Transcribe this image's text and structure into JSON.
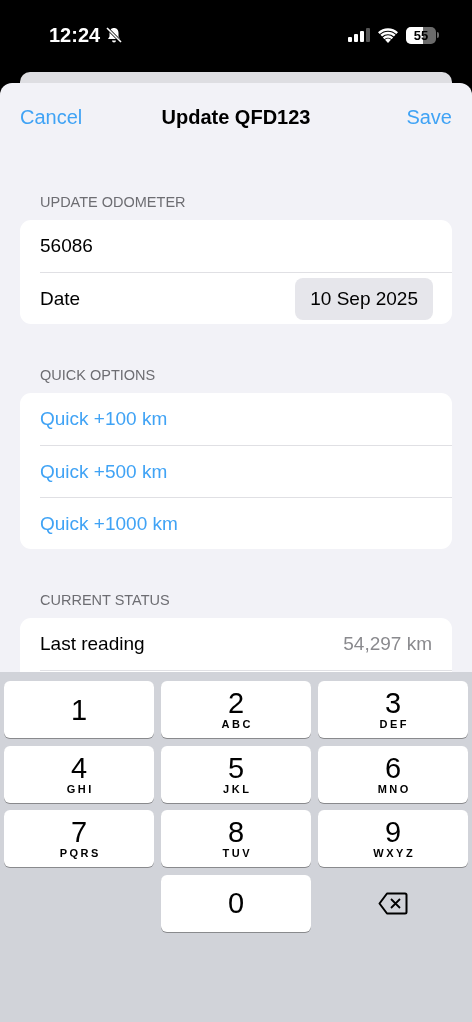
{
  "status_bar": {
    "time": "12:24",
    "silent": true,
    "battery": "55"
  },
  "nav": {
    "cancel": "Cancel",
    "title": "Update QFD123",
    "save": "Save"
  },
  "sections": [
    {
      "header": "UPDATE ODOMETER",
      "rows": [
        {
          "kind": "input",
          "value": "56086"
        },
        {
          "kind": "date",
          "label": "Date",
          "value": "10 Sep 2025"
        }
      ]
    },
    {
      "header": "QUICK OPTIONS",
      "rows": [
        {
          "kind": "action",
          "label": "Quick +100 km"
        },
        {
          "kind": "action",
          "label": "Quick +500 km"
        },
        {
          "kind": "action",
          "label": "Quick +1000 km"
        }
      ]
    },
    {
      "header": "CURRENT STATUS",
      "rows": [
        {
          "kind": "info",
          "label": "Last reading",
          "value": "54,297 km"
        }
      ]
    }
  ],
  "keypad": [
    {
      "kind": "digit",
      "digit": "1"
    },
    {
      "kind": "digit",
      "digit": "2",
      "letters": "ABC"
    },
    {
      "kind": "digit",
      "digit": "3",
      "letters": "DEF"
    },
    {
      "kind": "digit",
      "digit": "4",
      "letters": "GHI"
    },
    {
      "kind": "digit",
      "digit": "5",
      "letters": "JKL"
    },
    {
      "kind": "digit",
      "digit": "6",
      "letters": "MNO"
    },
    {
      "kind": "digit",
      "digit": "7",
      "letters": "PQRS"
    },
    {
      "kind": "digit",
      "digit": "8",
      "letters": "TUV"
    },
    {
      "kind": "digit",
      "digit": "9",
      "letters": "WXYZ"
    },
    {
      "kind": "blank"
    },
    {
      "kind": "digit",
      "digit": "0"
    },
    {
      "kind": "delete"
    }
  ]
}
